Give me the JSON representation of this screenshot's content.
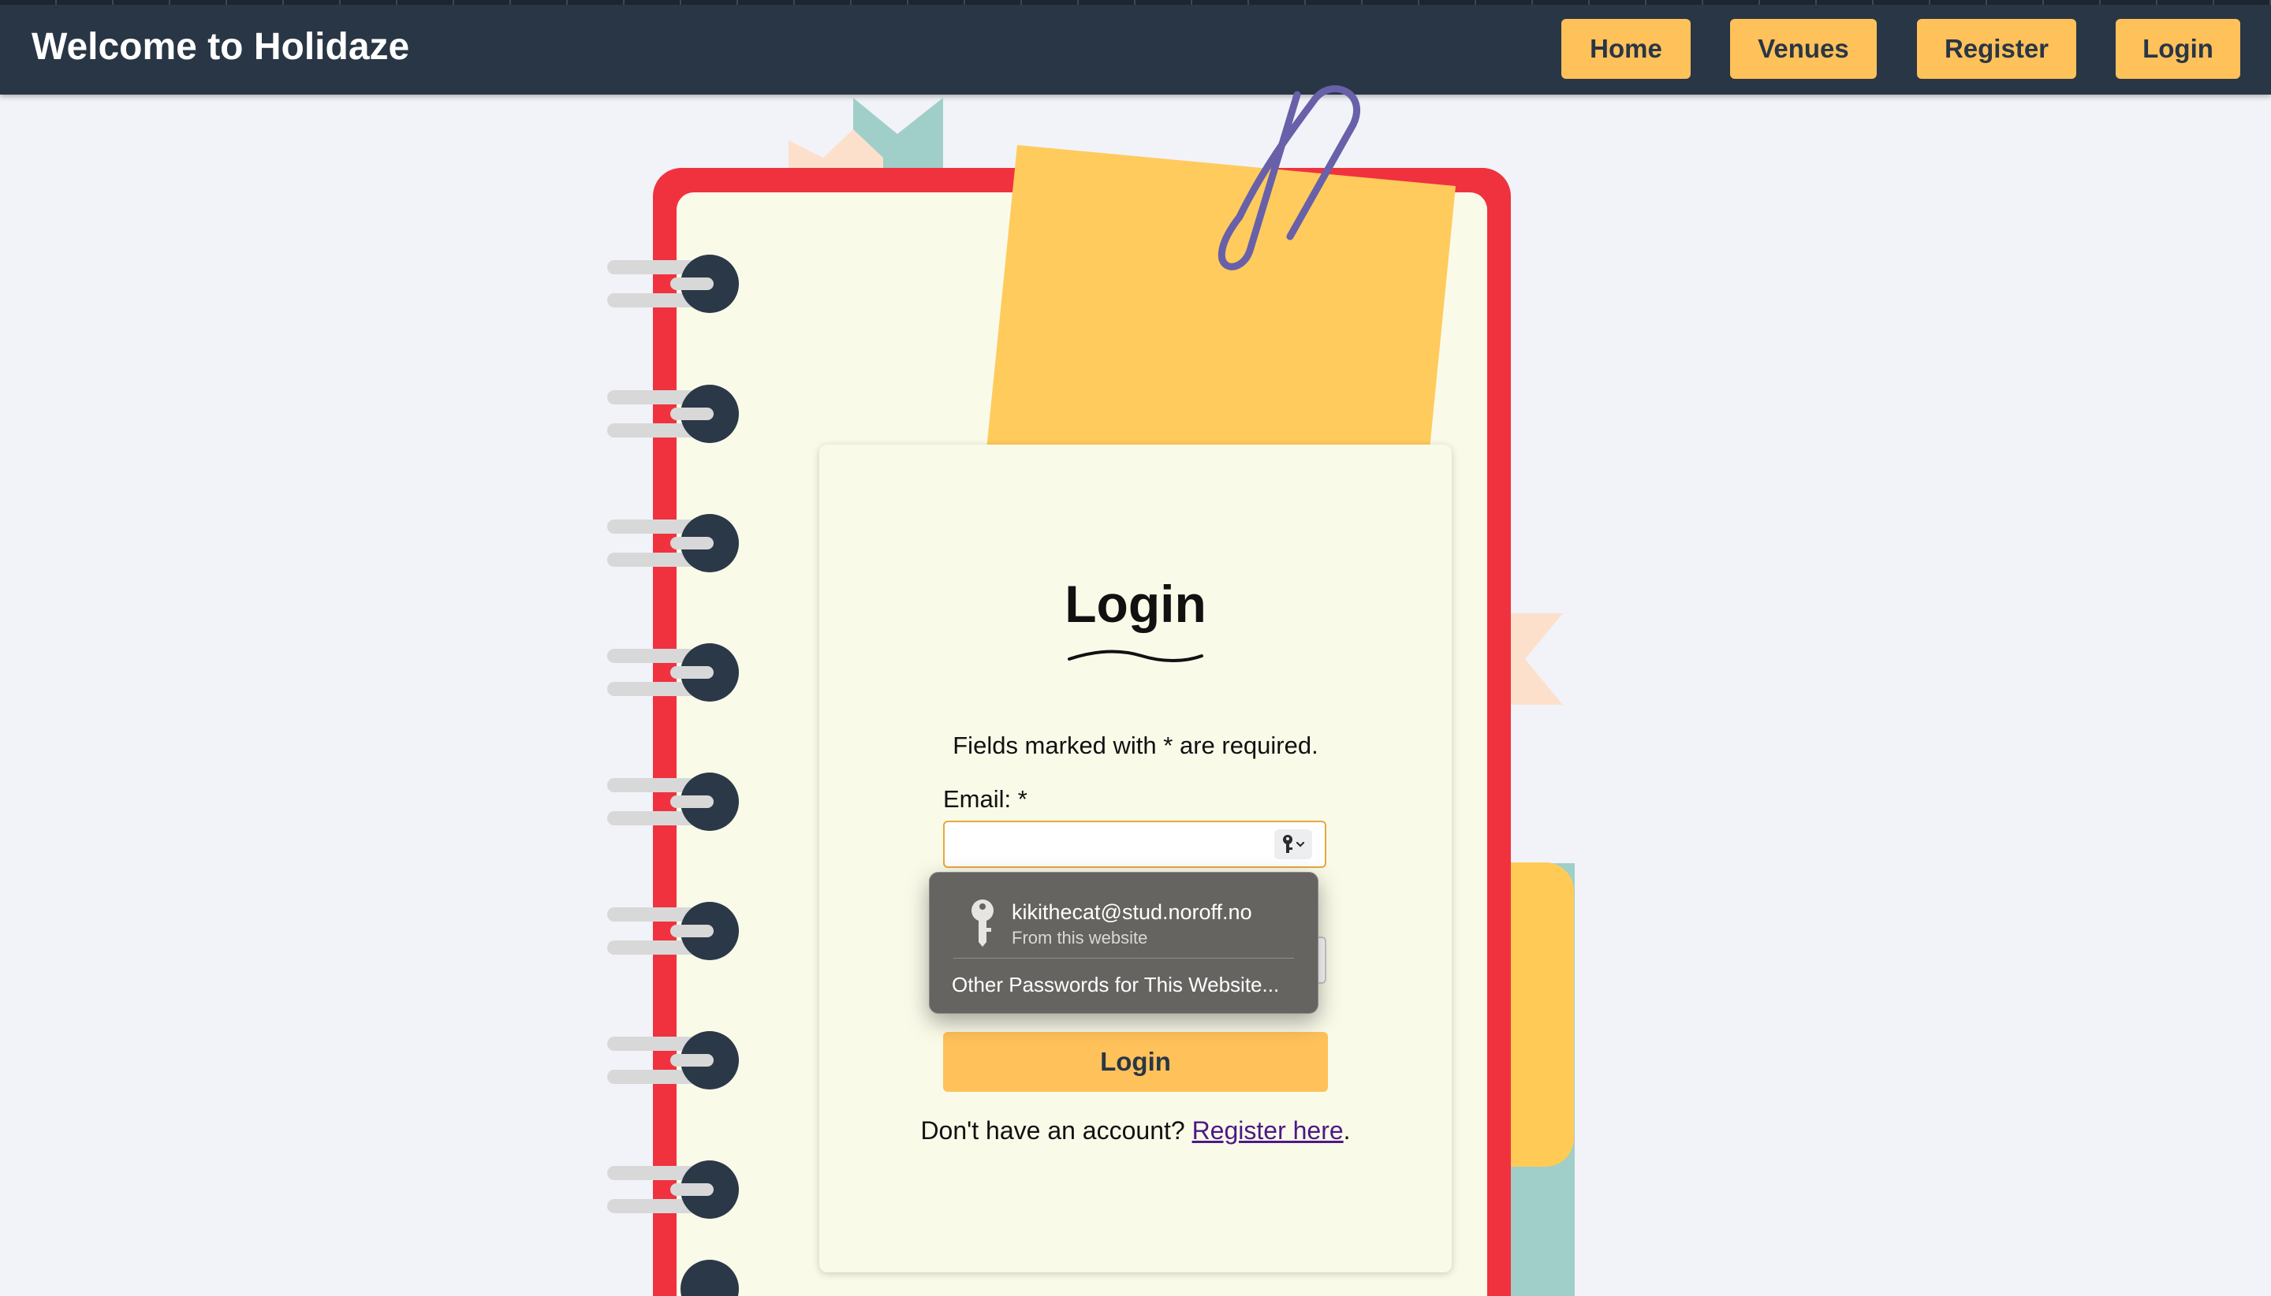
{
  "header": {
    "brand": "Welcome to Holidaze",
    "nav": {
      "home": "Home",
      "venues": "Venues",
      "register": "Register",
      "login": "Login"
    }
  },
  "form": {
    "title": "Login",
    "required_note": "Fields marked with * are required.",
    "email_label": "Email: *",
    "email_value": "",
    "submit_label": "Login",
    "register_prompt": "Don't have an account? ",
    "register_link": "Register here",
    "register_suffix": "."
  },
  "autofill": {
    "account": "kikithecat@stud.noroff.no",
    "source": "From this website",
    "other": "Other Passwords for This Website..."
  },
  "colors": {
    "nav_background": "#293645",
    "accent": "#ffc15a",
    "notebook_border": "#f0323f",
    "card_background": "#fafae9",
    "link": "#4b1a86"
  },
  "icons": {
    "key": "key-icon",
    "paperclip": "paperclip-icon"
  }
}
